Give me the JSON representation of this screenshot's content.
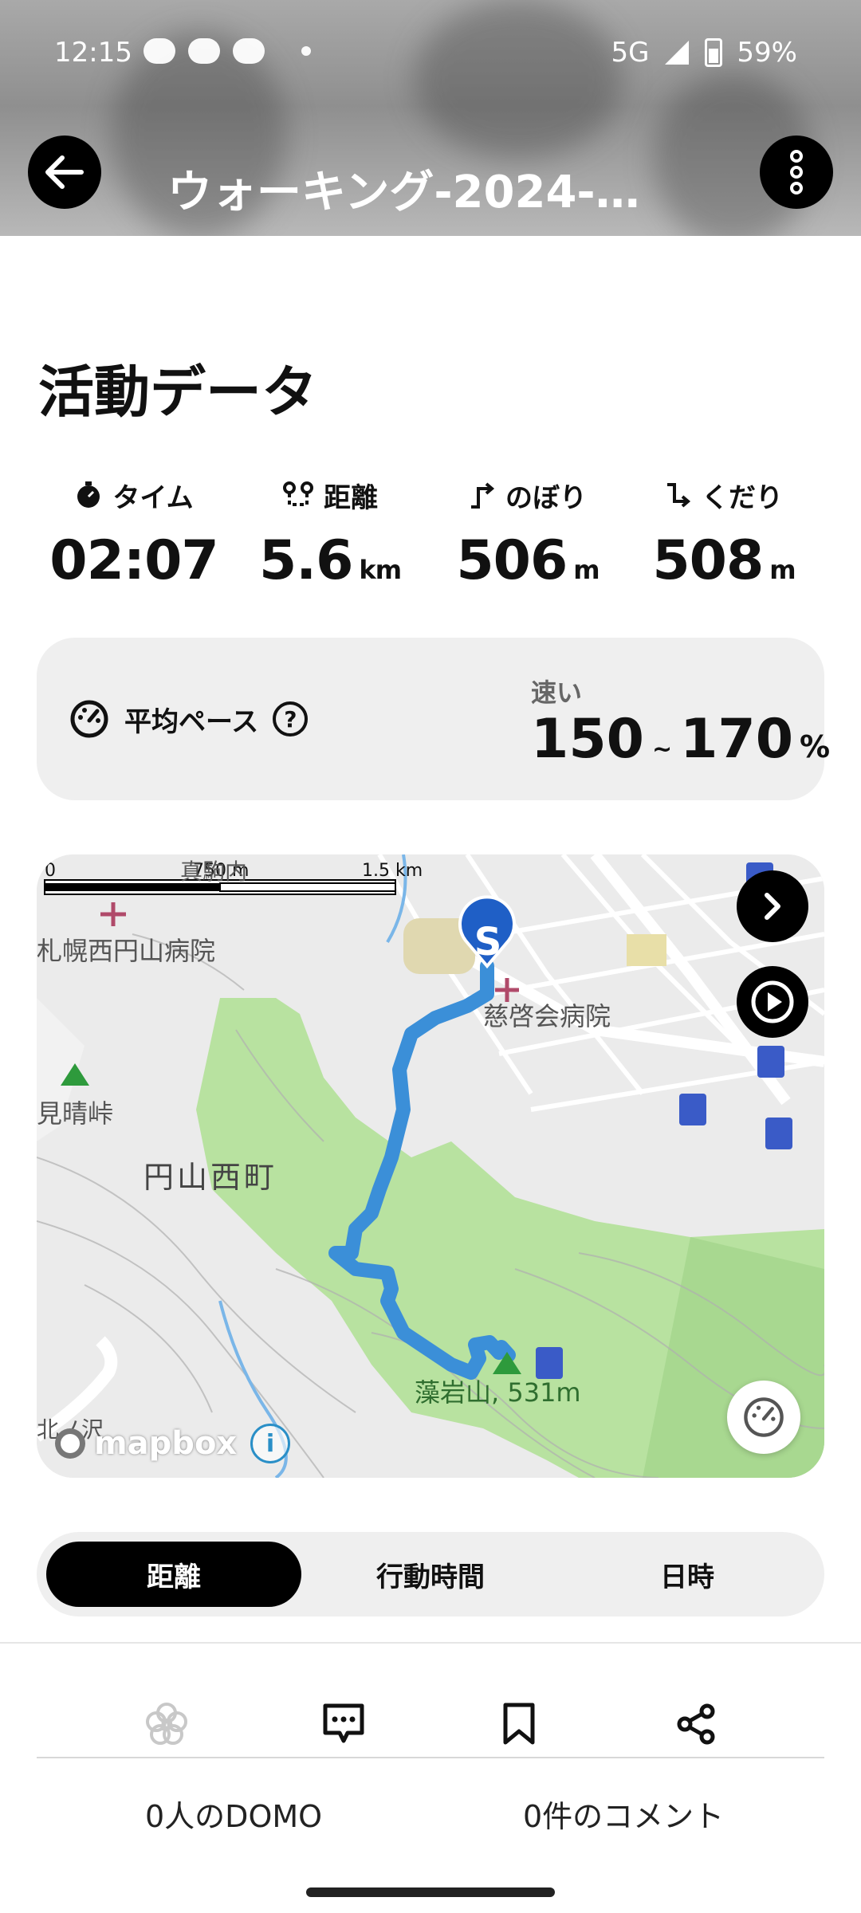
{
  "status_bar": {
    "time": "12:15",
    "network": "5G",
    "battery": "59%"
  },
  "header": {
    "title": "ウォーキング-2024-…"
  },
  "activity": {
    "section_title": "活動データ",
    "stats": [
      {
        "label": "タイム",
        "value": "02:07",
        "unit": "",
        "icon": "stopwatch-icon"
      },
      {
        "label": "距離",
        "value": "5.6",
        "unit": "km",
        "icon": "route-icon"
      },
      {
        "label": "のぼり",
        "value": "506",
        "unit": "m",
        "icon": "ascent-icon"
      },
      {
        "label": "くだり",
        "value": "508",
        "unit": "m",
        "icon": "descent-icon"
      }
    ]
  },
  "pace": {
    "label": "平均ペース",
    "help": "?",
    "speed_label": "速い",
    "min": "150",
    "tilde": "~",
    "max": "170",
    "unit": "%"
  },
  "map": {
    "scale_labels": [
      "0",
      "750 m",
      "1.5 km"
    ],
    "labels": {
      "hospital_west": "札幌西円山病院",
      "hospital_east": "慈啓会病院",
      "town": "円山西町",
      "pass": "見晴峠",
      "mountain": "藻岩山, 531m",
      "north": "真駒内",
      "sw": "北ノ沢"
    },
    "start_marker": "S",
    "attribution": "mapbox",
    "info": "i",
    "route_color": "#3b8fd8",
    "park_color": "#b8e2a0"
  },
  "tabs": [
    {
      "label": "距離",
      "active": true
    },
    {
      "label": "行動時間",
      "active": false
    },
    {
      "label": "日時",
      "active": false
    }
  ],
  "footer": {
    "domo_count": "0人のDOMO",
    "comment_count": "0件のコメント"
  }
}
